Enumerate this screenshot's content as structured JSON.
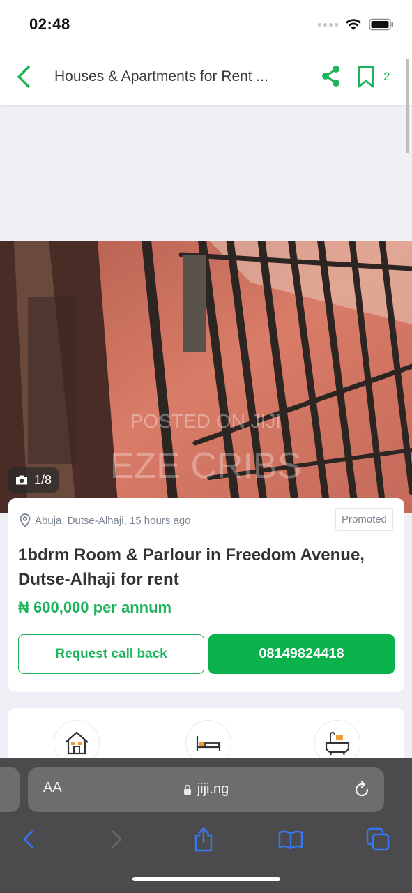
{
  "status_bar": {
    "time": "02:48"
  },
  "header": {
    "title": "Houses & Apartments for Rent ...",
    "bookmark_count": "2"
  },
  "photo": {
    "watermark_line1": "POSTED ON JIJI",
    "watermark_line2": "EZE CRIBS",
    "counter": "1/8"
  },
  "listing": {
    "location": "Abuja, Dutse-Alhaji, 15 hours ago",
    "badge": "Promoted",
    "title": "1bdrm Room & Parlour in Freedom Avenue, Dutse-Alhaji for rent",
    "price": "₦ 600,000 per annum",
    "callback_label": "Request call back",
    "phone_label": "08149824418"
  },
  "attributes": {
    "icons": [
      "house-icon",
      "bed-icon",
      "bathtub-icon"
    ]
  },
  "browser": {
    "aa_label": "AA",
    "url": "jiji.ng"
  },
  "colors": {
    "brand_green": "#1fb35b",
    "button_green": "#0bb24c",
    "accent_orange": "#f29b38",
    "safari_blue": "#3478f6"
  }
}
